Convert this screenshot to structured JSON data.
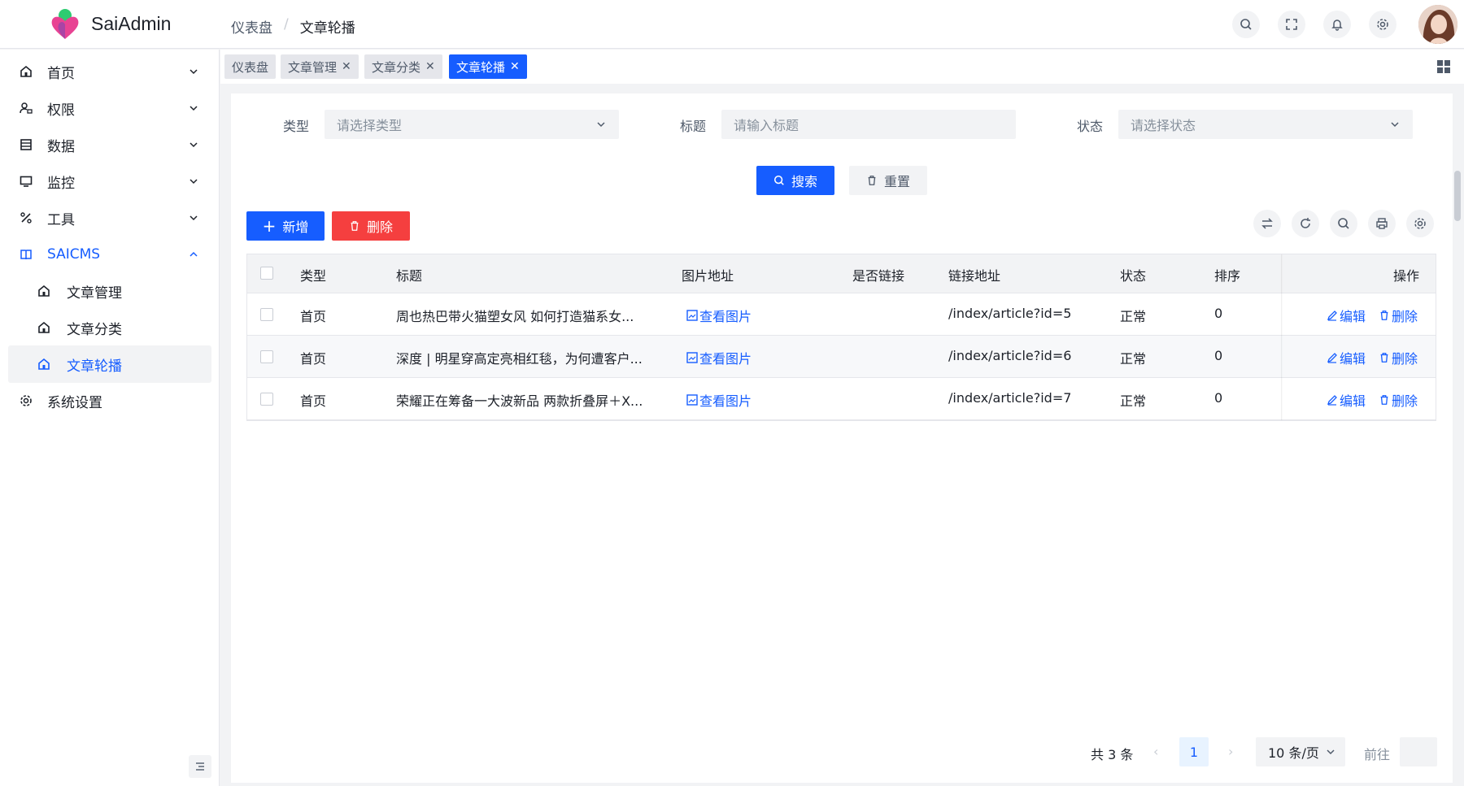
{
  "app": {
    "brand": "SaiAdmin",
    "accent": "#165dff"
  },
  "breadcrumb": [
    "仪表盘",
    "文章轮播"
  ],
  "sidebar": {
    "items": [
      {
        "label": "首页",
        "icon": "home-icon"
      },
      {
        "label": "权限",
        "icon": "user-lock-icon"
      },
      {
        "label": "数据",
        "icon": "list-icon"
      },
      {
        "label": "监控",
        "icon": "monitor-icon"
      },
      {
        "label": "工具",
        "icon": "tool-icon"
      },
      {
        "label": "SAICMS",
        "icon": "book-icon"
      },
      {
        "label": "文章管理",
        "icon": "home-icon"
      },
      {
        "label": "文章分类",
        "icon": "home-icon"
      },
      {
        "label": "文章轮播",
        "icon": "home-icon"
      },
      {
        "label": "系统设置",
        "icon": "gear-icon"
      }
    ]
  },
  "tabs": [
    "仪表盘",
    "文章管理",
    "文章分类",
    "文章轮播"
  ],
  "filters": {
    "type_label": "类型",
    "type_placeholder": "请选择类型",
    "title_label": "标题",
    "title_placeholder": "请输入标题",
    "status_label": "状态",
    "status_placeholder": "请选择状态",
    "search": "搜索",
    "reset": "重置"
  },
  "actions": {
    "add": "新增",
    "delete": "删除"
  },
  "table": {
    "headers": [
      "类型",
      "标题",
      "图片地址",
      "是否链接",
      "链接地址",
      "状态",
      "排序",
      "操作"
    ],
    "rows": [
      {
        "type": "首页",
        "title": "周也热巴带火猫塑女风 如何打造猫系女...",
        "image": "查看图片",
        "url": "/index/article?id=5",
        "status": "正常",
        "sort": "0"
      },
      {
        "type": "首页",
        "title": "深度 | 明星穿高定亮相红毯，为何遭客户...",
        "image": "查看图片",
        "url": "/index/article?id=6",
        "status": "正常",
        "sort": "0"
      },
      {
        "type": "首页",
        "title": "荣耀正在筹备一大波新品 两款折叠屏＋X...",
        "image": "查看图片",
        "url": "/index/article?id=7",
        "status": "正常",
        "sort": "0"
      }
    ],
    "edit": "编辑",
    "del": "删除"
  },
  "pagination": {
    "total": "共 3 条",
    "page": "1",
    "size": "10 条/页",
    "goto": "前往",
    "prev": "‹",
    "next": "›"
  }
}
